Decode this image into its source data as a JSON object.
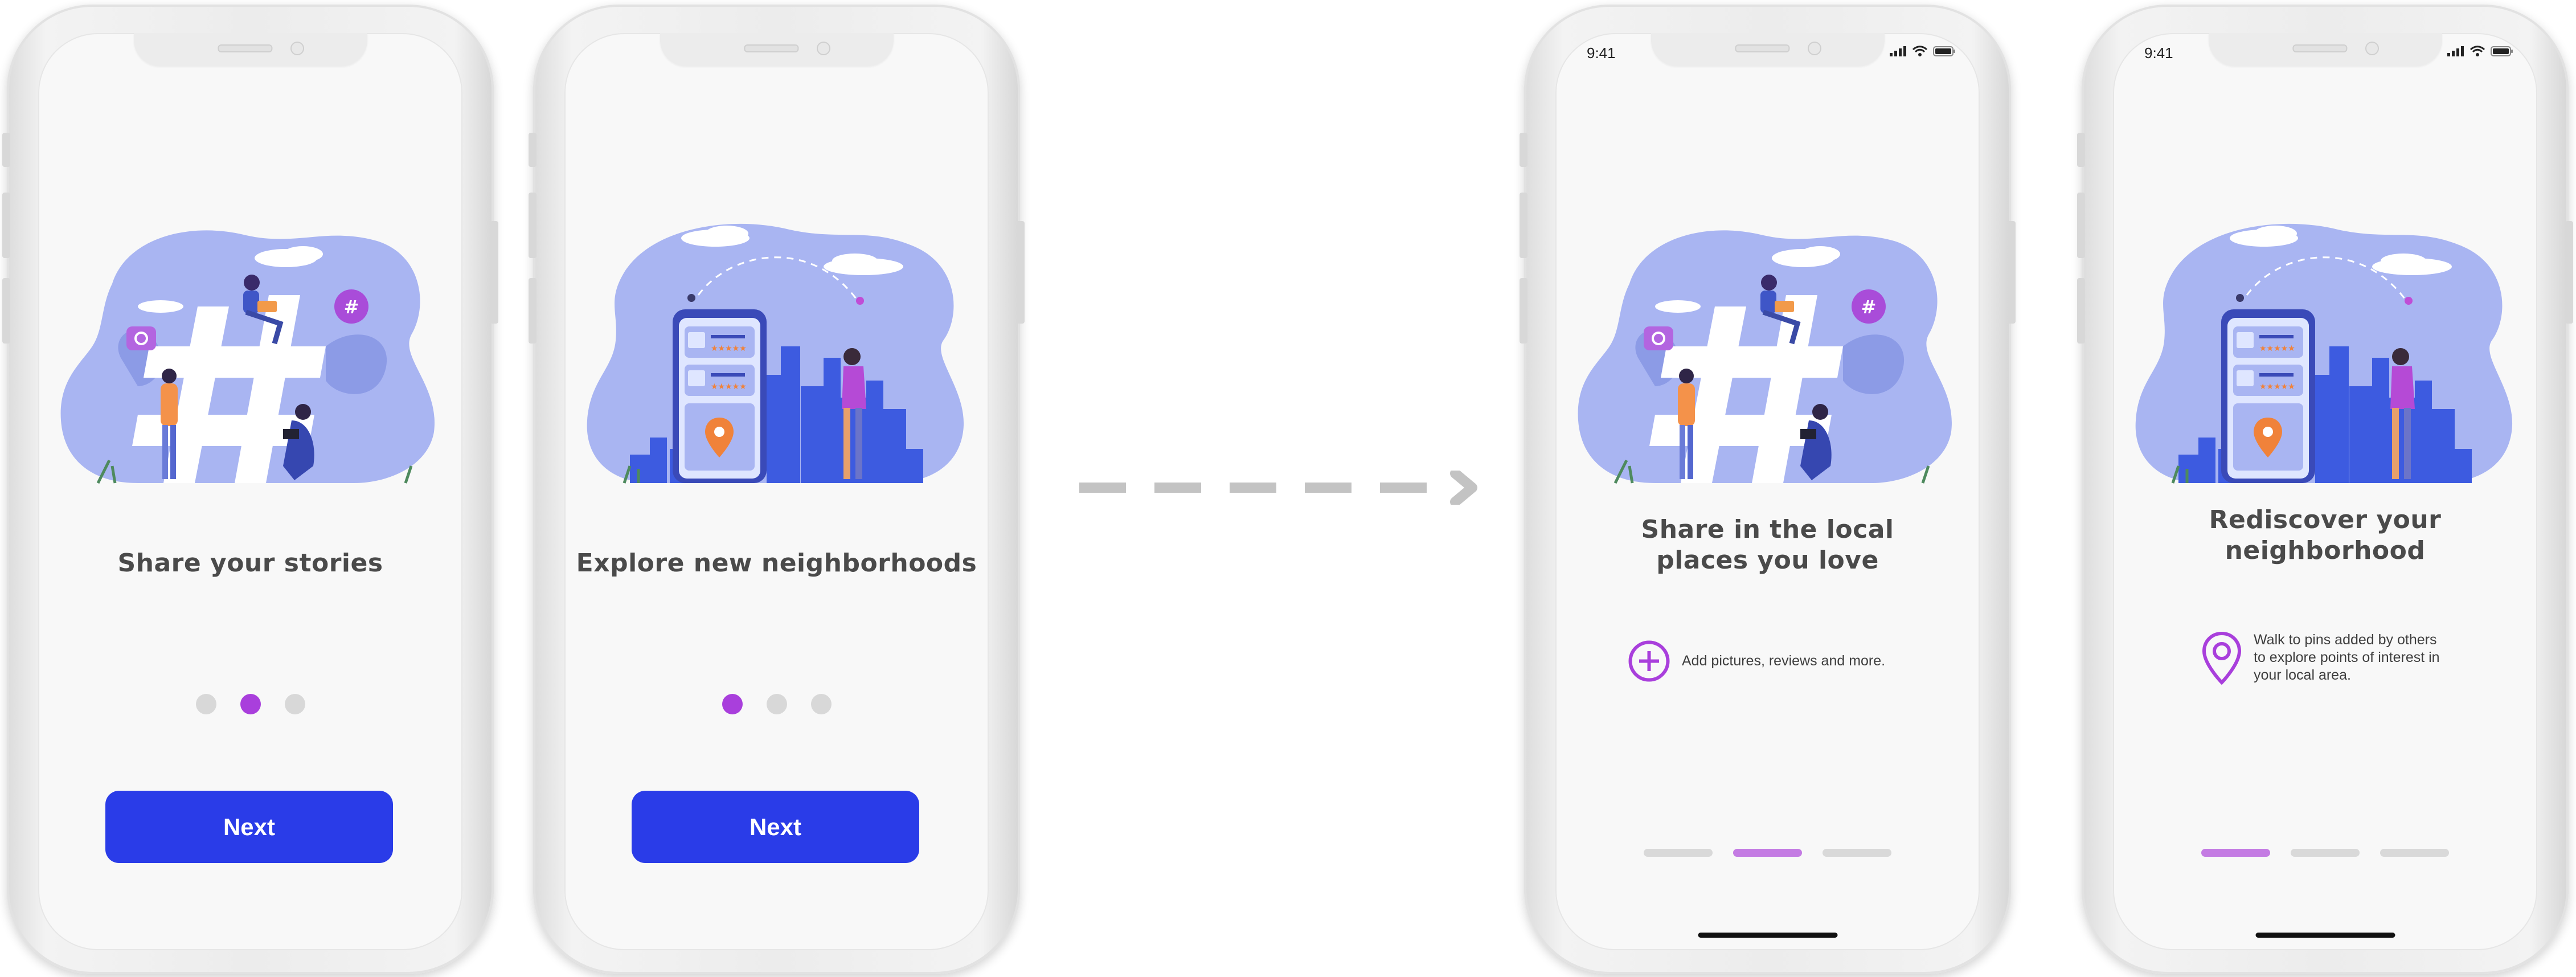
{
  "colors": {
    "accent": "#a93fdc",
    "button": "#2a3ce8",
    "indicator_active": "#c47be3",
    "blob": "#a9b5f2",
    "city": "#3d5be0"
  },
  "screen1": {
    "title": "Share your stories",
    "button_label": "Next",
    "page_dots": 3,
    "active_dot": 2
  },
  "screen2": {
    "title": "Explore new neighborhoods",
    "button_label": "Next",
    "page_dots": 3,
    "active_dot": 1
  },
  "screen3": {
    "status_time": "9:41",
    "title_line1": "Share in the local",
    "title_line2": "places you love",
    "feature_icon": "plus-circle-icon",
    "feature_text": "Add pictures, reviews and more.",
    "page_bars": 3,
    "active_bar": 2
  },
  "screen4": {
    "status_time": "9:41",
    "title_line1": "Rediscover your",
    "title_line2": "neighborhood",
    "feature_icon": "map-pin-icon",
    "feature_line1": "Walk to pins added by others",
    "feature_line2": "to explore points of interest in",
    "feature_line3": "your local area.",
    "page_bars": 3,
    "active_bar": 1
  }
}
